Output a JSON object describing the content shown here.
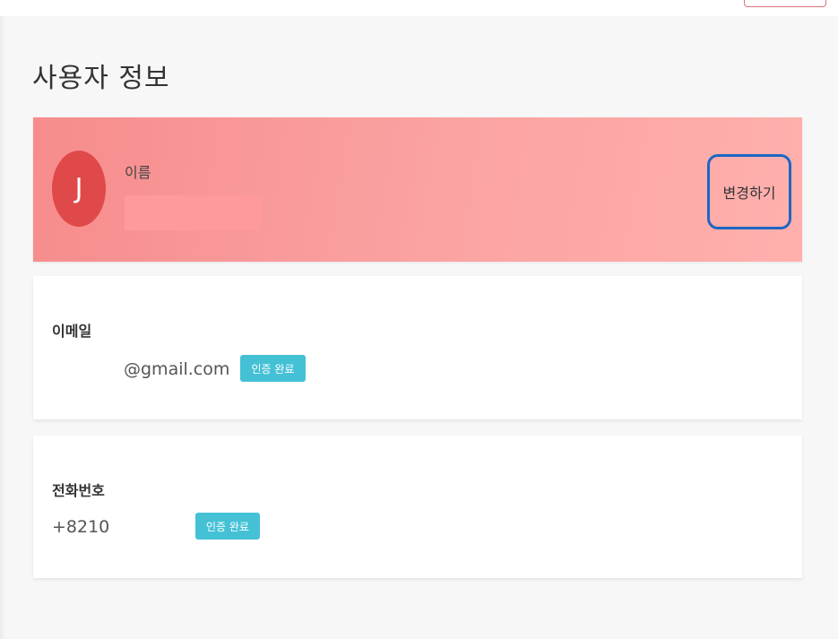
{
  "page": {
    "title": "사용자 정보"
  },
  "profile": {
    "avatar_initial": "J",
    "name_label": "이름",
    "change_button": "변경하기",
    "background_color": "#f78c8c",
    "avatar_color": "#e04949"
  },
  "email": {
    "label": "이메일",
    "value": "@gmail.com",
    "badge": "인증 완료"
  },
  "phone": {
    "label": "전화번호",
    "value": "+8210",
    "badge": "인증 완료"
  },
  "colors": {
    "badge": "#45c1d6",
    "highlight_border": "#1e66c4"
  }
}
